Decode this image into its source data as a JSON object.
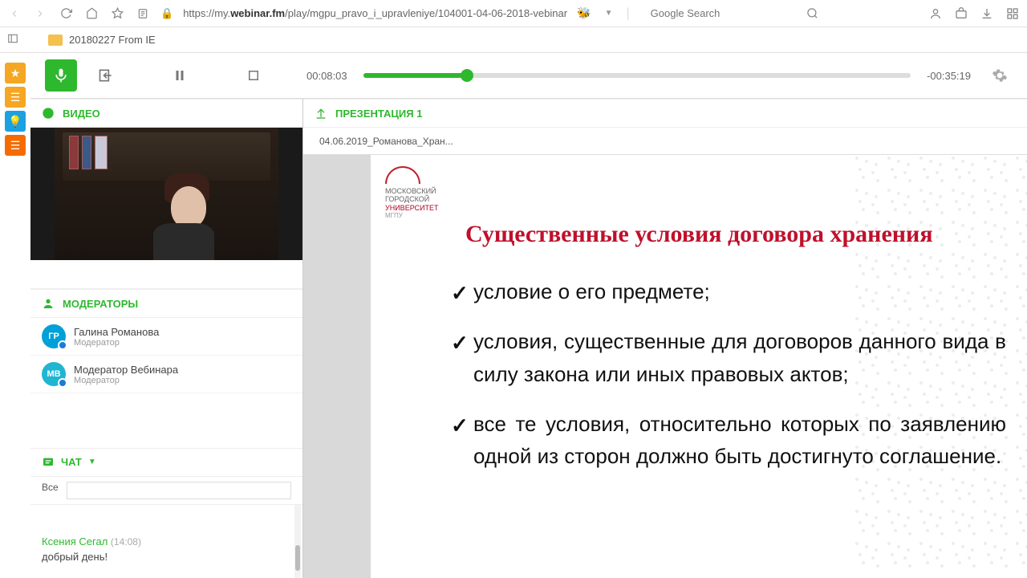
{
  "browser": {
    "url_host": "webinar.fm",
    "url_prefix": "https://my.",
    "url_path": "/play/mgpu_pravo_i_upravleniye/104001-04-06-2018-vebinar",
    "search_placeholder": "Google Search"
  },
  "bookmarks": {
    "folder": "20180227 From IE"
  },
  "player": {
    "elapsed": "00:08:03",
    "remaining": "-00:35:19",
    "progress_pct": 19
  },
  "panels": {
    "video": "ВИДЕО",
    "moderators": "МОДЕРАТОРЫ",
    "chat": "ЧАТ",
    "presentation": "ПРЕЗЕНТАЦИЯ 1"
  },
  "moderators": [
    {
      "initials": "ГР",
      "name": "Галина Романова",
      "role": "Модератор",
      "color": "#00a0d8"
    },
    {
      "initials": "МВ",
      "name": "Модератор Вебинара",
      "role": "Модератор",
      "color": "#1fb6d1"
    }
  ],
  "chat": {
    "filter": "Все",
    "messages": [
      {
        "user": "Ксения Сегал",
        "time": "(14:08)",
        "text": "добрый день!"
      }
    ]
  },
  "presentation": {
    "file": "04.06.2019_Романова_Хран...",
    "logo_lines": [
      "московский",
      "городской",
      "университет",
      "МГПУ"
    ],
    "title": "Существенные условия договора хранения",
    "bullets": [
      "условие о его предмете;",
      "условия, существенные для договоров данного вида в силу закона или иных правовых актов;",
      "все те условия, относительно которых по заявлению одной из сторон должно быть достигнуто соглашение."
    ]
  }
}
